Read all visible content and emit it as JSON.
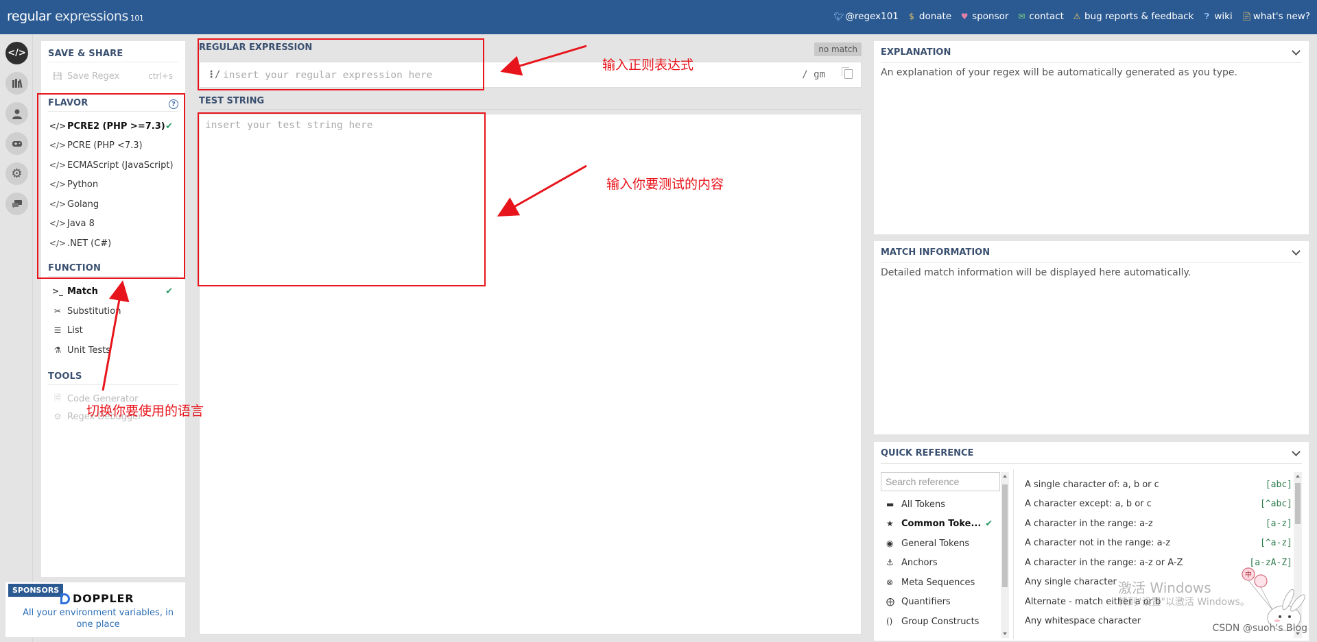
{
  "header": {
    "logo_regular": "regular",
    "logo_expressions": " expressions",
    "logo_version": "101",
    "nav": [
      {
        "label": "@regex101",
        "icon": "twitter-icon"
      },
      {
        "label": "donate",
        "icon": "dollar-icon"
      },
      {
        "label": "sponsor",
        "icon": "heart-icon"
      },
      {
        "label": "contact",
        "icon": "envelope-icon"
      },
      {
        "label": "bug reports & feedback",
        "icon": "warning-icon"
      },
      {
        "label": "wiki",
        "icon": "question-bubble-icon"
      },
      {
        "label": "what's new?",
        "icon": "document-icon"
      }
    ]
  },
  "rail": [
    "code-icon",
    "library-icon",
    "user-icon",
    "quiz-icon",
    "settings-icon",
    "chat-icon"
  ],
  "sidebar": {
    "save_share_title": "SAVE & SHARE",
    "save_regex_label": "Save Regex",
    "save_regex_shortcut": "ctrl+s",
    "flavor_title": "FLAVOR",
    "flavor_help": "?",
    "flavors": [
      "PCRE2 (PHP >=7.3)",
      "PCRE (PHP <7.3)",
      "ECMAScript (JavaScript)",
      "Python",
      "Golang",
      "Java 8",
      ".NET (C#)"
    ],
    "selected_flavor": "PCRE2 (PHP >=7.3)",
    "function_title": "FUNCTION",
    "functions": [
      {
        "label": "Match",
        "icon": "terminal-icon"
      },
      {
        "label": "Substitution",
        "icon": "scissors-icon"
      },
      {
        "label": "List",
        "icon": "list-icon"
      },
      {
        "label": "Unit Tests",
        "icon": "flask-icon"
      }
    ],
    "selected_function": "Match",
    "tools_title": "TOOLS",
    "tools": [
      {
        "label": "Code Generator",
        "icon": "code-file-icon"
      },
      {
        "label": "Regex Debugger",
        "icon": "bug-icon"
      }
    ]
  },
  "sponsor": {
    "badge": "SPONSORS",
    "brand": "DOPPLER",
    "text": "All your environment variables, in one place"
  },
  "editor": {
    "regex_title": "REGULAR EXPRESSION",
    "status": "no match",
    "regex_delimiter": "/",
    "regex_placeholder": "insert your regular expression here",
    "regex_flags": "/ gm",
    "test_title": "TEST STRING",
    "test_placeholder": "insert your test string here"
  },
  "explanation": {
    "title": "EXPLANATION",
    "body": "An explanation of your regex will be automatically generated as you type."
  },
  "match_info": {
    "title": "MATCH INFORMATION",
    "body": "Detailed match information will be displayed here automatically."
  },
  "quick_reference": {
    "title": "QUICK REFERENCE",
    "search_placeholder": "Search reference",
    "categories": [
      {
        "label": "All Tokens",
        "icon": "stack-icon"
      },
      {
        "label": "Common Toke...",
        "icon": "star-icon"
      },
      {
        "label": "General Tokens",
        "icon": "target-icon"
      },
      {
        "label": "Anchors",
        "icon": "anchor-icon"
      },
      {
        "label": "Meta Sequences",
        "icon": "meta-icon"
      },
      {
        "label": "Quantifiers",
        "icon": "quantifier-icon"
      },
      {
        "label": "Group Constructs",
        "icon": "parentheses-icon"
      }
    ],
    "selected_category": "Common Toke...",
    "rows": [
      {
        "desc": "A single character of: a, b or c",
        "token": "[abc]"
      },
      {
        "desc": "A character except: a, b or c",
        "token": "[^abc]"
      },
      {
        "desc": "A character in the range: a-z",
        "token": "[a-z]"
      },
      {
        "desc": "A character not in the range: a-z",
        "token": "[^a-z]"
      },
      {
        "desc": "A character in the range: a-z or A-Z",
        "token": "[a-zA-Z]"
      },
      {
        "desc": "Any single character",
        "token": ""
      },
      {
        "desc": "Alternate - match either a or b",
        "token": ""
      },
      {
        "desc": "Any whitespace character",
        "token": ""
      }
    ]
  },
  "annotations": {
    "regex_note": "输入正则表达式",
    "test_note": "输入你要测试的内容",
    "flavor_note": "切换你要使用的语言",
    "color": "#e8141b"
  },
  "watermark": {
    "windows_title": "激活 Windows",
    "windows_sub": "转到\"设置\"以激活 Windows。",
    "csdn": "CSDN @suoh's Blog"
  }
}
